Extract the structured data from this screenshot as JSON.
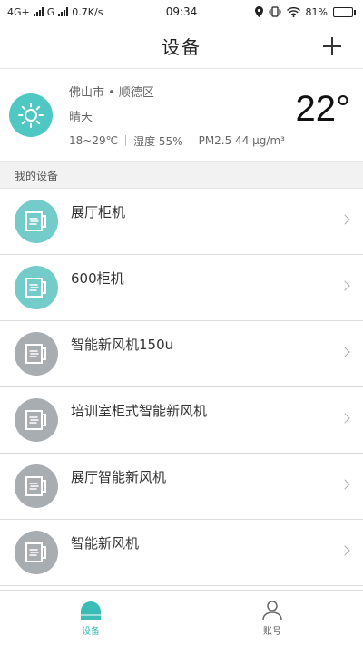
{
  "status_bar": {
    "network1": "4G+",
    "network2": "G",
    "speed": "0.7K/s",
    "time": "09:34",
    "battery": "81%",
    "battery_level": 0.81
  },
  "header": {
    "title": "设备"
  },
  "weather": {
    "city": "佛山市 • 顺德区",
    "condition": "晴天",
    "range": "18~29℃",
    "humidity": "湿度 55%",
    "pm": "PM2.5 44 μg/m³",
    "temperature": "22°"
  },
  "section": {
    "title": "我的设备"
  },
  "devices": [
    {
      "name": "展厅柜机"
    },
    {
      "name": "600柜机"
    },
    {
      "name": "智能新风机150u"
    },
    {
      "name": "培训室柜式智能新风机"
    },
    {
      "name": "展厅智能新风机"
    },
    {
      "name": "智能新风机"
    }
  ],
  "nav": {
    "devices_label": "设备",
    "account_label": "账号"
  },
  "colors": {
    "accent": "#4fc8c4",
    "device_online": "#73ccc9",
    "device_offline": "#a8adb2"
  }
}
